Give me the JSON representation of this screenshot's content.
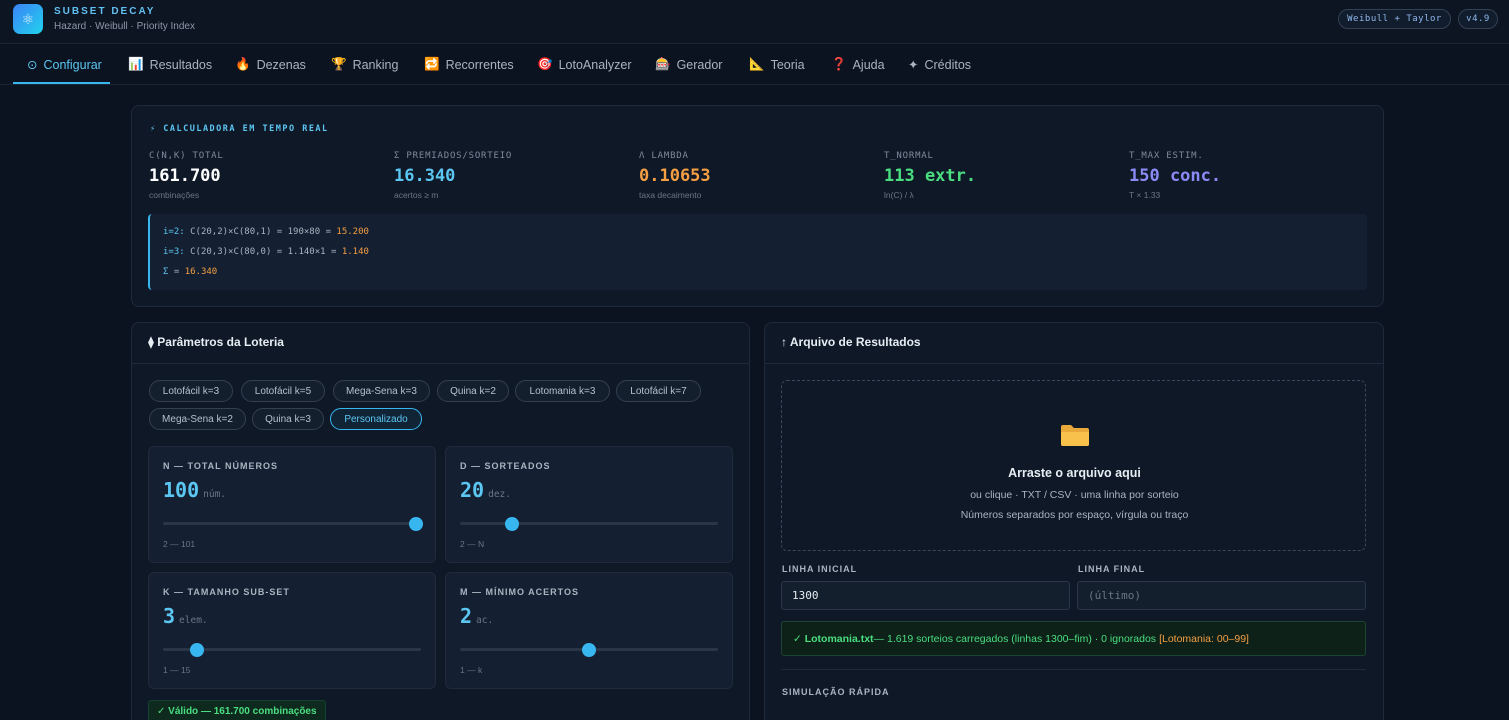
{
  "header": {
    "title": "SUBSET DECAY",
    "subtitle": "Hazard · Weibull · Priority Index",
    "badge": "Weibull + Taylor",
    "version": "v4.9"
  },
  "nav": {
    "tabs": [
      {
        "icon": "⊙",
        "label": "Configurar"
      },
      {
        "icon": "📊",
        "label": "Resultados"
      },
      {
        "icon": "🔥",
        "label": "Dezenas"
      },
      {
        "icon": "🏆",
        "label": "Ranking"
      },
      {
        "icon": "🔁",
        "label": "Recorrentes"
      },
      {
        "icon": "🎯",
        "label": "LotoAnalyzer"
      },
      {
        "icon": "🎰",
        "label": "Gerador"
      },
      {
        "icon": "📐",
        "label": "Teoria"
      },
      {
        "icon": "❓",
        "label": "Ajuda"
      },
      {
        "icon": "✦",
        "label": "Créditos"
      }
    ]
  },
  "calculator": {
    "heading": "⚡  CALCULADORA EM TEMPO REAL",
    "stats": [
      {
        "label": "C(N,K) TOTAL",
        "value": "161.700",
        "sub": "combinações",
        "color": "#ffffff"
      },
      {
        "label": "Σ PREMIADOS/SORTEIO",
        "value": "16.340",
        "sub": "acertos ≥ m",
        "color": "#5cc6f2"
      },
      {
        "label": "Λ LAMBDA",
        "value": "0.10653",
        "sub": "taxa decaimento",
        "color": "#f59e42"
      },
      {
        "label": "T_NORMAL",
        "value": "113 extr.",
        "sub": "ln(C) / λ",
        "color": "#4ade80"
      },
      {
        "label": "T_MAX ESTIM.",
        "value": "150 conc.",
        "sub": "T × 1.33",
        "color": "#8b8bf5"
      }
    ],
    "formula": [
      {
        "key": "i=2:",
        "expr": " C(20,2)×C(80,1) = 190×80 = ",
        "result": "15.200"
      },
      {
        "key": "i=3:",
        "expr": " C(20,3)×C(80,0) = 1.140×1 = ",
        "result": "1.140"
      },
      {
        "key": "Σ",
        "expr": " = ",
        "result": "16.340"
      }
    ]
  },
  "params": {
    "title": "⧫ Parâmetros da Loteria",
    "presets": [
      "Lotofácil k=3",
      "Lotofácil k=5",
      "Mega-Sena k=3",
      "Quina k=2",
      "Lotomania k=3",
      "Lotofácil k=7",
      "Mega-Sena k=2",
      "Quina k=3",
      "Personalizado"
    ],
    "active_preset": "Personalizado",
    "controls": [
      {
        "label": "N — TOTAL NÚMEROS",
        "value": "100",
        "unit": "núm.",
        "range": "2 — 101",
        "fraction": 0.98
      },
      {
        "label": "D — SORTEADOS",
        "value": "20",
        "unit": "dez.",
        "range": "2 — N",
        "fraction": 0.2
      },
      {
        "label": "K — TAMANHO SUB-SET",
        "value": "3",
        "unit": "elem.",
        "range": "1 — 15",
        "fraction": 0.13
      },
      {
        "label": "M — MÍNIMO ACERTOS",
        "value": "2",
        "unit": "ac.",
        "range": "1 — k",
        "fraction": 0.5
      }
    ],
    "valid_text": "✓ Válido — 161.700 combinações"
  },
  "upload": {
    "title": "↑ Arquivo de Resultados",
    "dz_title": "Arraste o arquivo aqui",
    "dz_line1": "ou clique · TXT / CSV · uma linha por sorteio",
    "dz_line2": "Números separados por espaço, vírgula ou traço",
    "start_label": "LINHA INICIAL",
    "start_value": "1300",
    "end_label": "LINHA FINAL",
    "end_placeholder": "(último)",
    "status_file": "✓ Lotomania.txt",
    "status_text": " — 1.619 sorteios carregados (linhas 1300–fim) · 0 ignorados",
    "status_extra": "[Lotomania: 00–99]",
    "sim_label": "SIMULAÇÃO RÁPIDA"
  }
}
